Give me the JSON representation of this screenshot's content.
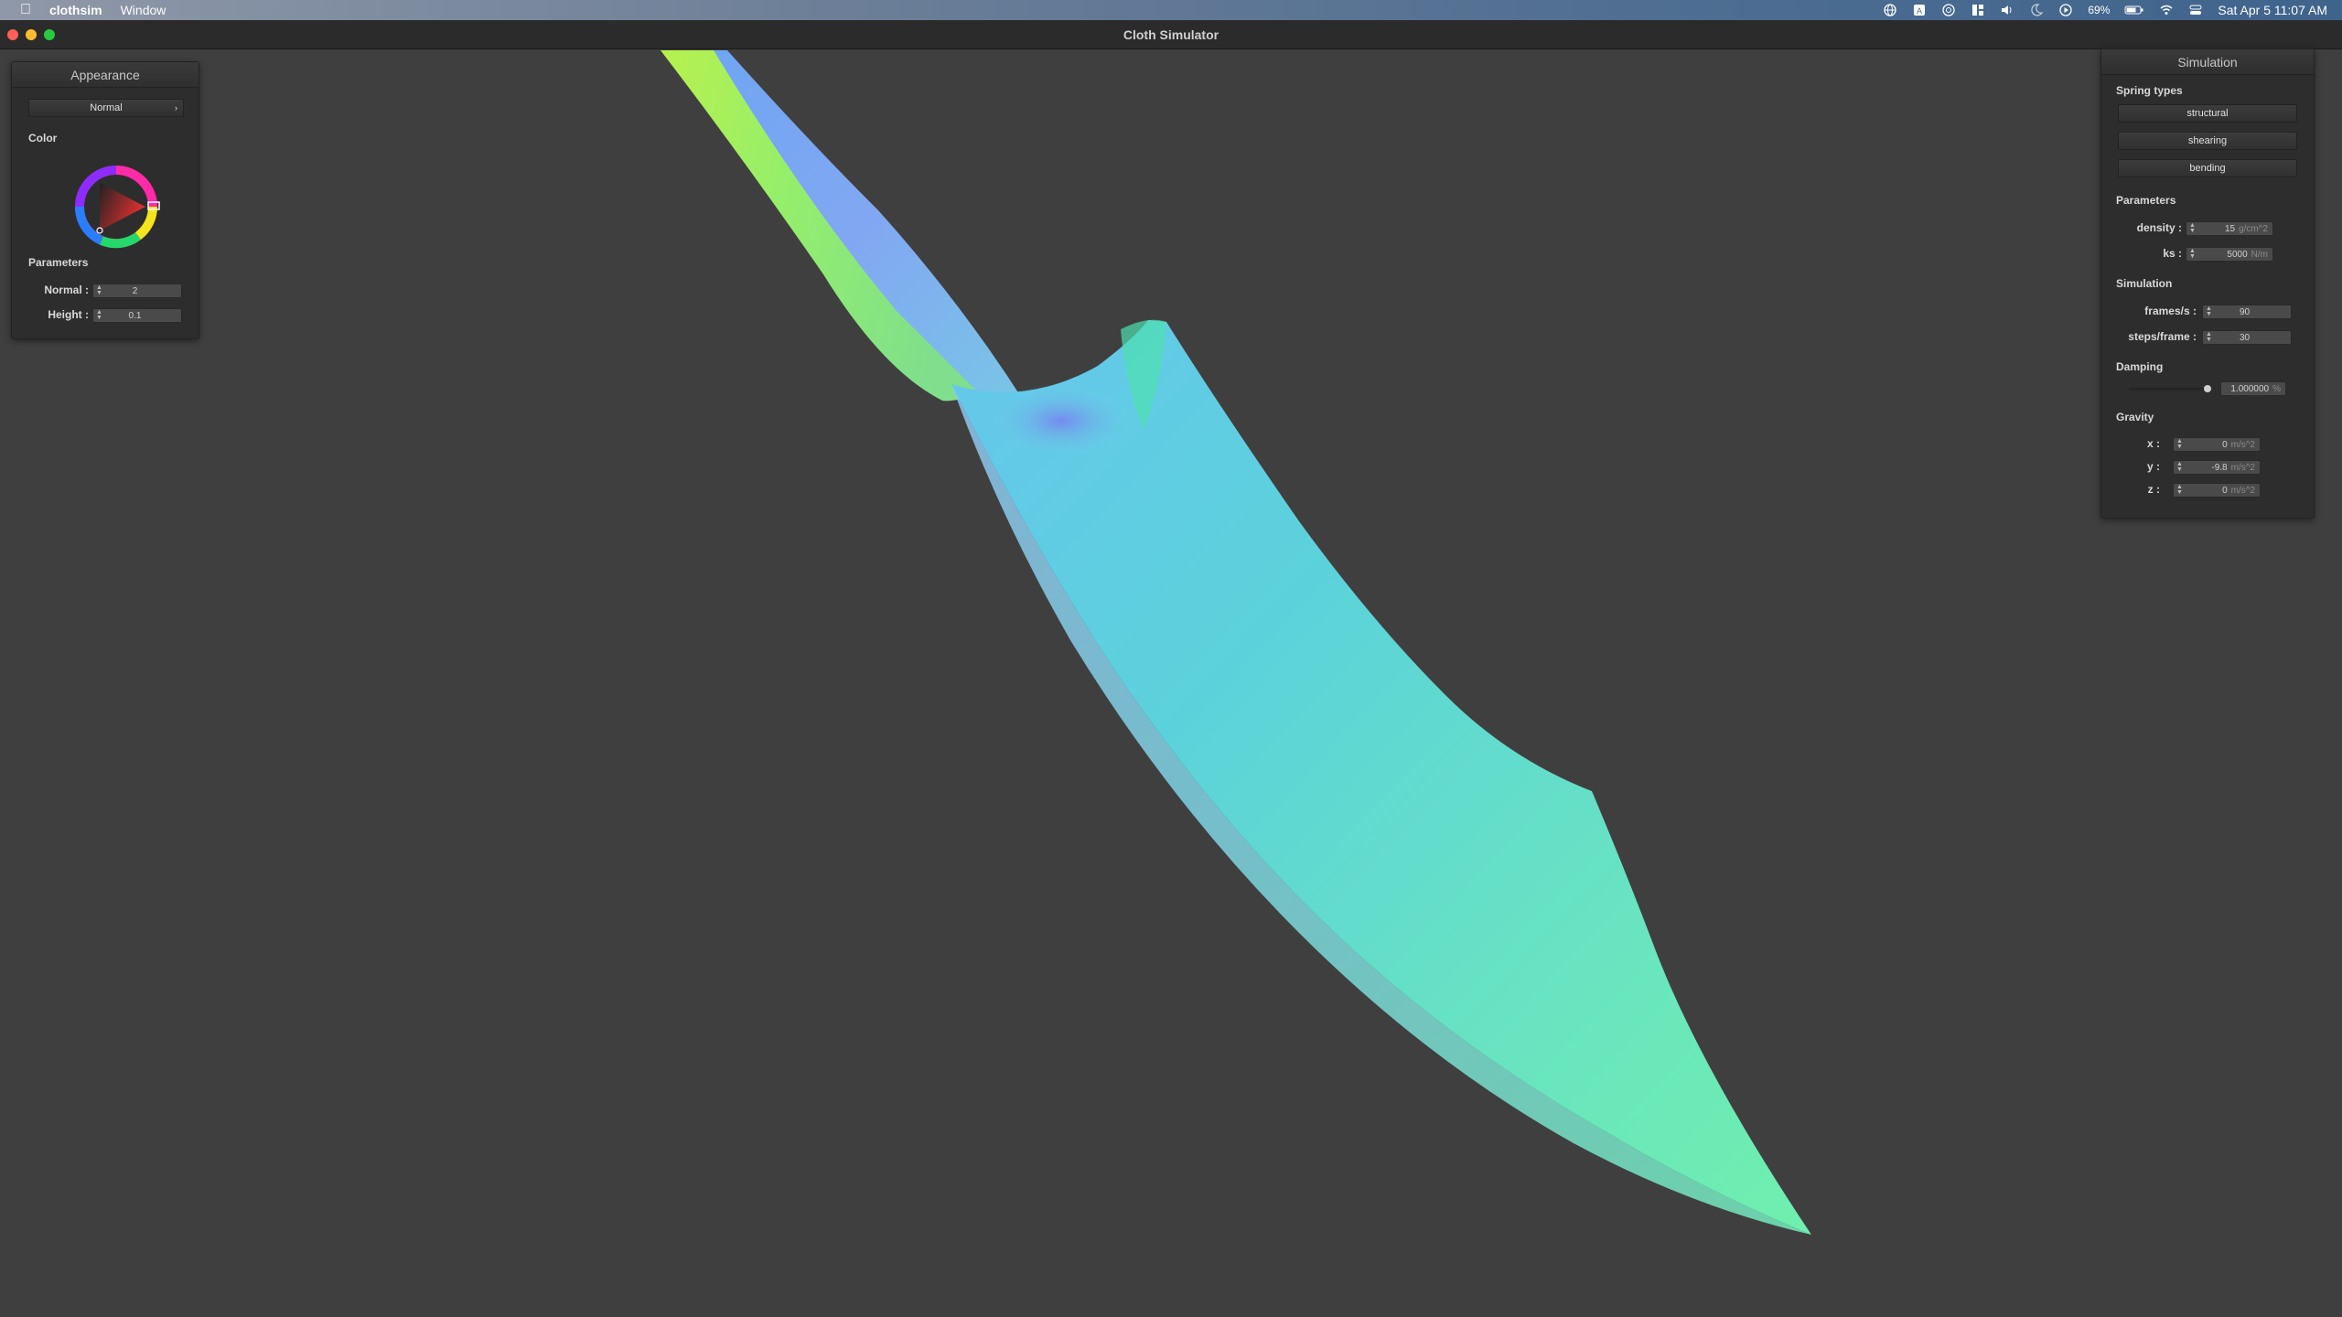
{
  "menubar": {
    "app_name": "clothsim",
    "items": [
      "Window"
    ],
    "battery": "69%",
    "clock": "Sat Apr 5  11:07 AM"
  },
  "window": {
    "title": "Cloth Simulator"
  },
  "appearance": {
    "title": "Appearance",
    "shader_dropdown": "Normal",
    "color_label": "Color",
    "parameters_label": "Parameters",
    "normal_label": "Normal :",
    "normal_value": "2",
    "height_label": "Height :",
    "height_value": "0.1"
  },
  "simulation": {
    "title": "Simulation",
    "spring_types_label": "Spring types",
    "spring_types": [
      "structural",
      "shearing",
      "bending"
    ],
    "parameters_label": "Parameters",
    "density_label": "density :",
    "density_value": "15",
    "density_unit": "g/cm^2",
    "ks_label": "ks :",
    "ks_value": "5000",
    "ks_unit": "N/m",
    "sim_label": "Simulation",
    "fps_label": "frames/s :",
    "fps_value": "90",
    "steps_label": "steps/frame :",
    "steps_value": "30",
    "damping_label": "Damping",
    "damping_value": "1.000000",
    "damping_unit": "%",
    "gravity_label": "Gravity",
    "gx_label": "x :",
    "gx_value": "0",
    "gy_label": "y :",
    "gy_value": "-9.8",
    "gz_label": "z :",
    "gz_value": "0",
    "gravity_unit": "m/s^2"
  }
}
